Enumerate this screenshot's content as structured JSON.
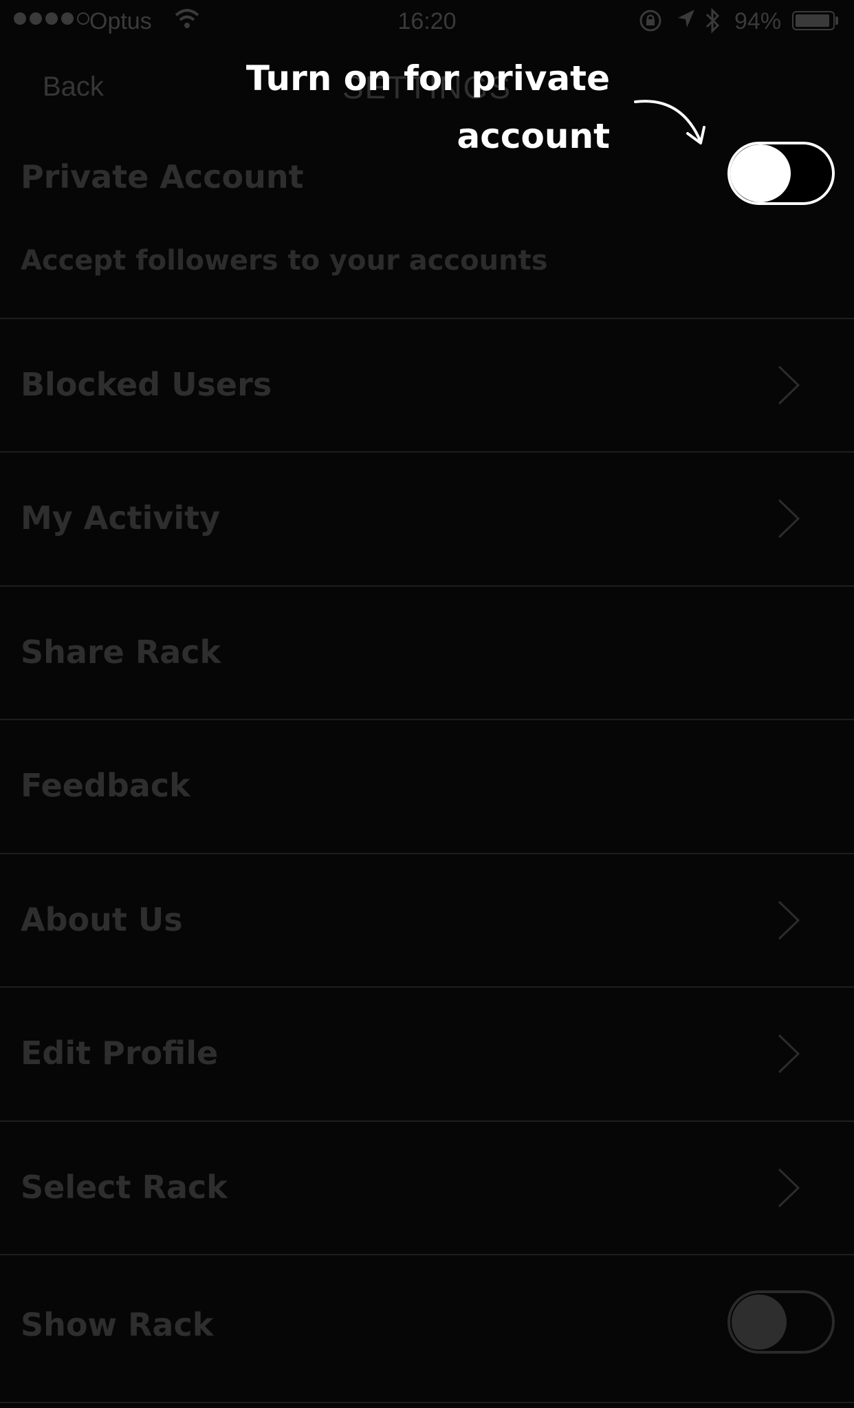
{
  "status_bar": {
    "carrier": "Optus",
    "time": "16:20",
    "battery_percent": "94%",
    "battery_level": 0.94,
    "signal_filled_dots": 4,
    "signal_total_dots": 5,
    "icons": [
      "wifi-icon",
      "rotation-lock-icon",
      "location-arrow-icon",
      "bluetooth-icon",
      "battery-icon"
    ]
  },
  "nav": {
    "back_label": "Back",
    "title": "SETTINGS"
  },
  "annotation": {
    "line1": "Turn on for private",
    "line2": "account"
  },
  "settings": {
    "private_account": {
      "label": "Private Account",
      "sublabel": "Accept followers to your accounts",
      "toggle": "on"
    },
    "items": [
      {
        "label": "Blocked Users",
        "chevron": true
      },
      {
        "label": "My Activity",
        "chevron": true
      },
      {
        "label": "Share Rack",
        "chevron": false
      },
      {
        "label": "Feedback",
        "chevron": false
      },
      {
        "label": "About Us",
        "chevron": true
      },
      {
        "label": "Edit Profile",
        "chevron": true
      },
      {
        "label": "Select Rack",
        "chevron": true
      }
    ],
    "show_rack": {
      "label": "Show Rack",
      "toggle": "off"
    }
  },
  "colors": {
    "background": "#060606",
    "dim_text": "#2e2e2e",
    "annotation_text": "#ffffff",
    "separator": "#1e1e1e"
  }
}
